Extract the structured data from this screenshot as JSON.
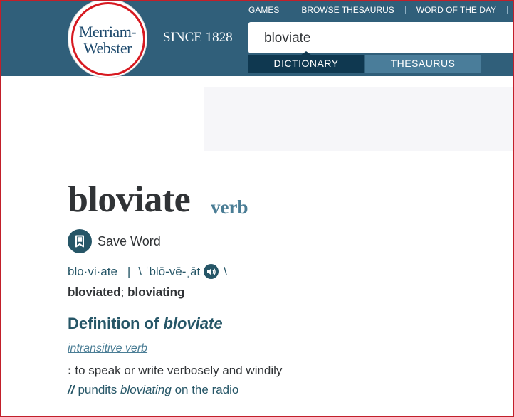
{
  "header": {
    "logo_line1": "Merriam-",
    "logo_line2": "Webster",
    "since": "SINCE 1828",
    "nav": [
      "GAMES",
      "BROWSE THESAURUS",
      "WORD OF THE DAY"
    ],
    "search_value": "bloviate",
    "tabs": {
      "dictionary": "DICTIONARY",
      "thesaurus": "THESAURUS"
    },
    "active_tab": "dictionary"
  },
  "entry": {
    "headword": "bloviate",
    "part_of_speech": "verb",
    "save_label": "Save Word",
    "syllables": "blo·vi·ate",
    "pronunciation_open": "\\ ˈblō-vē-ˌāt",
    "pronunciation_close": "\\",
    "inflection1": "bloviated",
    "inflection_sep": ";",
    "inflection2": "bloviating",
    "definition_heading_prefix": "Definition of",
    "definition_heading_word": "bloviate",
    "function_label": "intransitive verb",
    "sense_colon": ":",
    "sense_text": "to speak or write verbosely and windily",
    "example_prefix": "pundits",
    "example_word": "bloviating",
    "example_suffix": "on the radio"
  }
}
